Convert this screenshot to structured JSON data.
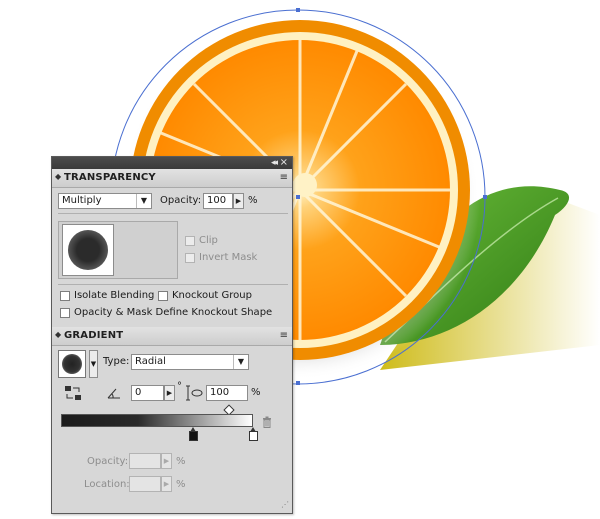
{
  "panel": {
    "titlebar": {
      "collapse_glyph": "◂◂",
      "close_glyph": "×"
    }
  },
  "transparency": {
    "tab_label": "TRANSPARENCY",
    "blend_mode": "Multiply",
    "opacity_label": "Opacity:",
    "opacity_value": "100",
    "percent_sign": "%",
    "clip_label": "Clip",
    "invert_mask_label": "Invert Mask",
    "isolate_blending_label": "Isolate Blending",
    "knockout_group_label": "Knockout Group",
    "opacity_mask_knockout_label": "Opacity & Mask Define Knockout Shape"
  },
  "gradient": {
    "tab_label": "GRADIENT",
    "type_label": "Type:",
    "type_value": "Radial",
    "angle_value": "0",
    "degree_sign": "°",
    "aspect_value": "100",
    "percent_sign": "%",
    "opacity_label": "Opacity:",
    "location_label": "Location:",
    "opacity_percent": "%",
    "location_percent": "%"
  },
  "icons": {
    "tab_menu": "≡",
    "tab_arrow": "◆",
    "dropdown": "▼",
    "spin": "▶",
    "trash": "🗑"
  },
  "colors": {
    "panel_bg": "#d7d7d7",
    "titlebar": "#3a3a3a",
    "orange_peel": "#f08c00",
    "orange_flesh": "#ffa515",
    "leaf": "#3f8f1e",
    "selection_blue": "#4a6fd1"
  }
}
